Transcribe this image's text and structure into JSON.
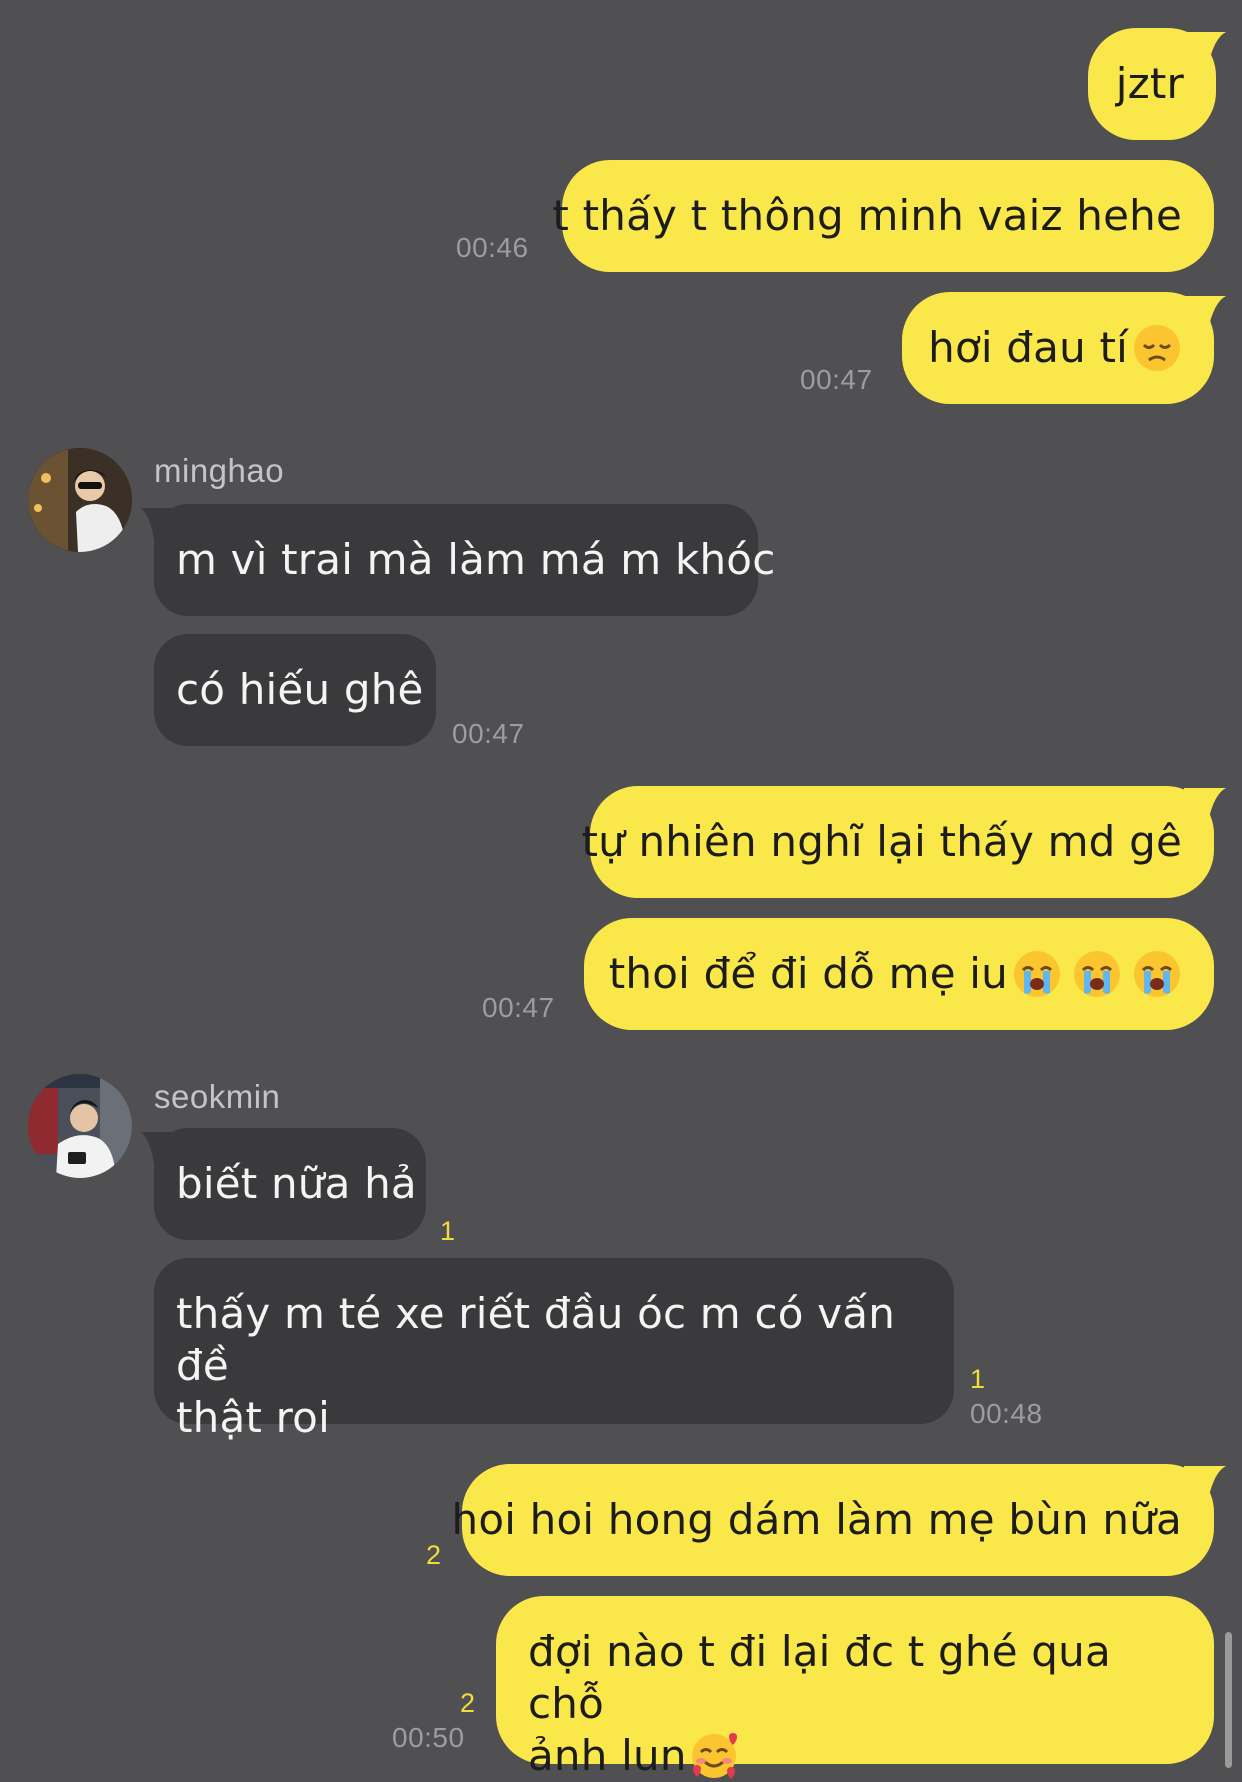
{
  "colors": {
    "background": "#504f51",
    "outgoing_bubble": "#fae84a",
    "incoming_bubble": "#3a393b",
    "unread_count": "#f1dc3b",
    "timestamp": "#9d9c9e"
  },
  "messages": {
    "m1": {
      "text": "jztr"
    },
    "m2": {
      "text": "t thấy t thông minh vaiz hehe",
      "time": "00:46"
    },
    "m3": {
      "text": "hơi đau tí",
      "emoji": "disappointed-face",
      "time": "00:47"
    },
    "m4": {
      "sender": "minghao",
      "avatar": "profile-photo",
      "text": "m vì trai mà làm má m khóc"
    },
    "m5": {
      "text": "có hiếu ghê",
      "time": "00:47"
    },
    "m6": {
      "text": "tự nhiên nghĩ lại thấy md gê"
    },
    "m7": {
      "text": "thoi để đi dỗ mẹ iu",
      "emoji": "loudly-crying-face x3",
      "time": "00:47"
    },
    "m8": {
      "sender": "seokmin",
      "avatar": "profile-photo",
      "text": "biết nữa hả",
      "unread": "1"
    },
    "m9": {
      "text_line1": "thấy m té xe riết đầu óc m có vấn đề",
      "text_line2": "thật roi",
      "unread": "1",
      "time": "00:48"
    },
    "m10": {
      "text": "hoi hoi hong dám làm mẹ bùn nữa",
      "unread": "2"
    },
    "m11": {
      "text_line1": "đợi nào t đi lại đc t ghé qua chỗ",
      "text_line2": "ảnh lun",
      "emoji": "smiling-face-with-hearts",
      "unread": "2",
      "time": "00:50"
    }
  }
}
